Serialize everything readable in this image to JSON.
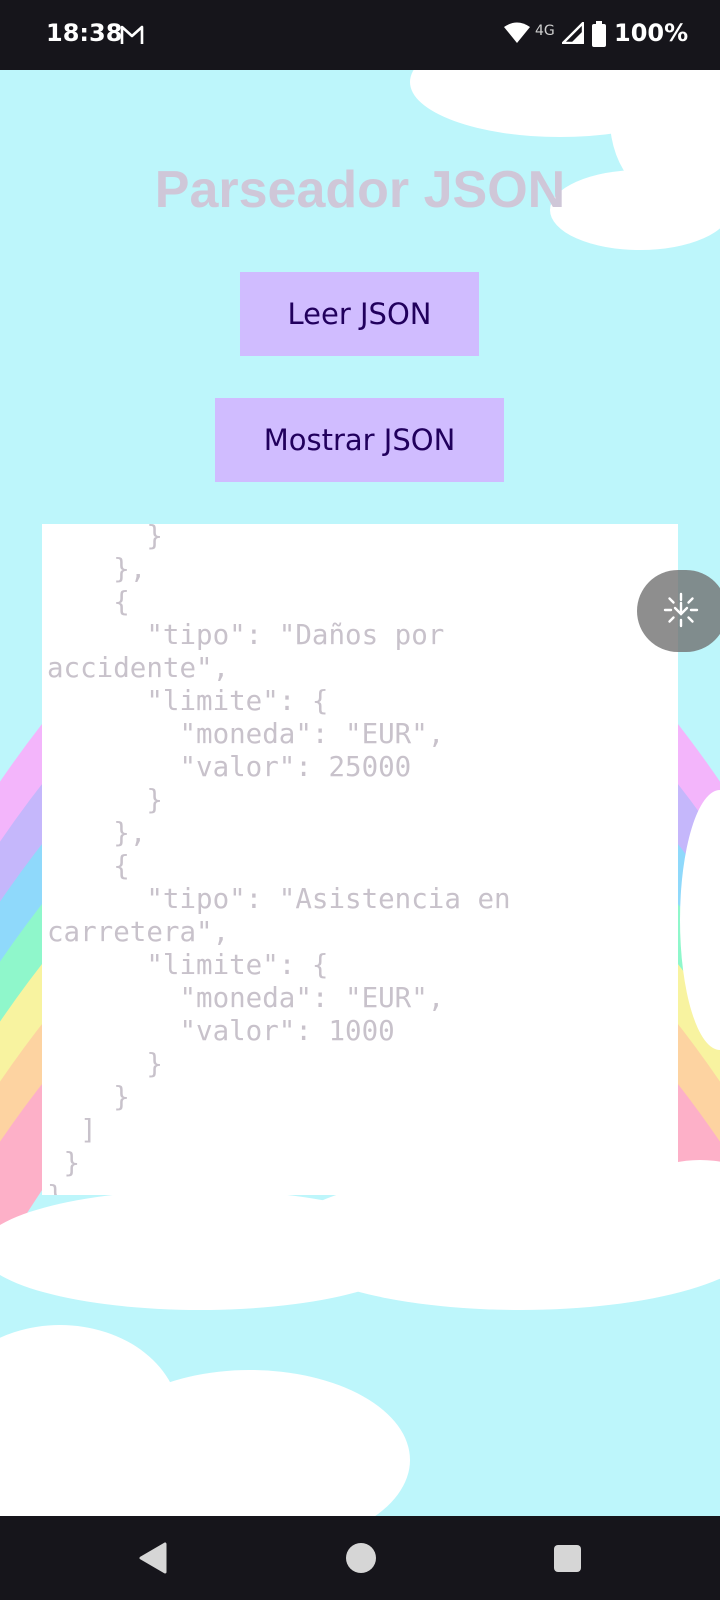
{
  "status_bar": {
    "time": "18:38",
    "network": "4G",
    "battery": "100%",
    "icons": [
      "gmail-icon",
      "wifi-icon",
      "signal-icon",
      "battery-icon"
    ]
  },
  "app": {
    "title": "Parseador JSON",
    "read_button": "Leer JSON",
    "show_button": "Mostrar JSON",
    "json_content": "      }\n    },\n    {\n      \"tipo\": \"Daños por\naccidente\",\n      \"limite\": {\n        \"moneda\": \"EUR\",\n        \"valor\": 25000\n      }\n    },\n    {\n      \"tipo\": \"Asistencia en\ncarretera\",\n      \"limite\": {\n        \"moneda\": \"EUR\",\n        \"valor\": 1000\n      }\n    }\n  ]\n }\n}"
  },
  "colors": {
    "button_bg": "#d0bcff",
    "button_text": "#21005d",
    "title_text": "#cfc7d8",
    "json_text": "#c8c2cb",
    "sky": "#bdf6fb"
  },
  "floating": {
    "icon": "assistant-sparkle-icon"
  },
  "nav_bar": {
    "icons": [
      "back-icon",
      "home-icon",
      "recents-icon"
    ]
  }
}
